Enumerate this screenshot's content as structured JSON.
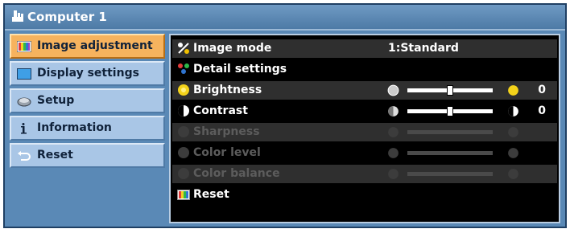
{
  "window": {
    "title": "Computer 1",
    "icon": "computer-hand-icon"
  },
  "sidebar": {
    "items": [
      {
        "label": "Image adjustment",
        "icon": "image-adjustment-icon",
        "active": true
      },
      {
        "label": "Display settings",
        "icon": "display-icon",
        "active": false
      },
      {
        "label": "Setup",
        "icon": "setup-icon",
        "active": false
      },
      {
        "label": "Information",
        "icon": "info-icon",
        "active": false
      },
      {
        "label": "Reset",
        "icon": "reset-icon",
        "active": false
      }
    ]
  },
  "menu": {
    "image_mode": {
      "label": "Image mode",
      "value": "1:Standard",
      "icon": "percent-icon"
    },
    "detail_settings": {
      "label": "Detail settings",
      "icon": "detail-settings-icon"
    },
    "brightness": {
      "label": "Brightness",
      "value": "0",
      "level": 0.5,
      "icon": "sun-icon"
    },
    "contrast": {
      "label": "Contrast",
      "value": "0",
      "level": 0.5,
      "icon": "contrast-icon"
    },
    "sharpness": {
      "label": "Sharpness",
      "enabled": false,
      "icon": "sharpness-icon"
    },
    "color_level": {
      "label": "Color level",
      "enabled": false,
      "icon": "color-level-icon"
    },
    "color_balance": {
      "label": "Color balance",
      "enabled": false,
      "icon": "color-balance-icon"
    },
    "reset": {
      "label": "Reset",
      "icon": "reset-image-icon"
    }
  },
  "colors": {
    "frame": "#5a89b6",
    "active_item": "#f6b35e",
    "inactive_item": "#a9c6e6",
    "panel": "#000000",
    "disabled_text": "#5c5c5c"
  }
}
